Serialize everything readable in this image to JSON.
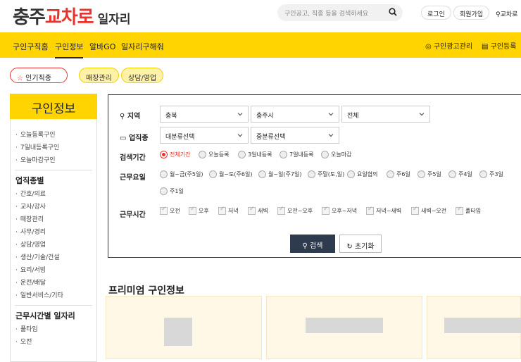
{
  "header": {
    "logo_part1": "충주",
    "logo_part2": "교차로",
    "logo_part3": "일자리",
    "search_placeholder": "구인공고, 직종 등을 검색하세요",
    "login": "로그인",
    "signup": "회원가입",
    "link": "교차로"
  },
  "nav": {
    "items": [
      "구인구직홈",
      "구인정보",
      "알바GO",
      "일자리구해줘"
    ],
    "right": [
      "구인광고관리",
      "구인등록"
    ]
  },
  "chips": [
    "인기직종",
    "매장관리",
    "상담/영업"
  ],
  "sidebar": {
    "title": "구인정보",
    "links1": [
      "오늘등록구인",
      "7일내등록구인",
      "오늘마감구인"
    ],
    "section1": "업직종별",
    "links2": [
      "간호/의료",
      "교사/강사",
      "매장관리",
      "사무/경리",
      "상담/영업",
      "생산/기술/건설",
      "요리/서빙",
      "운전/배달",
      "일반서비스/기타"
    ],
    "section2": "근무시간별 일자리",
    "links3": [
      "풀타임",
      "오전"
    ]
  },
  "filter": {
    "region_label": "지역",
    "region_sel": [
      "충북",
      "충주시",
      "전체"
    ],
    "job_label": "업직종",
    "job_sel": [
      "대분류선택",
      "중분류선택"
    ],
    "period_label": "검색기간",
    "period_opts": [
      "전체기간",
      "오늘등록",
      "3일내등록",
      "7일내등록",
      "오늘마감"
    ],
    "day_label": "근무요일",
    "day_opts": [
      "월~금(주5일)",
      "월~토(주6일)",
      "월~일(주7일)",
      "주말(토,일)",
      "요일협의",
      "주6일",
      "주5일",
      "주4일",
      "주3일"
    ],
    "day_opts2": [
      "주1일"
    ],
    "time_label": "근무시간",
    "time_opts": [
      "오전",
      "오후",
      "저녁",
      "새벽",
      "오전~오후",
      "오후~저녁",
      "저녁~새벽",
      "새벽~오전",
      "풀타임"
    ],
    "search_btn": "검색",
    "reset_btn": "초기화"
  },
  "premium": {
    "title": "프리미엄 구인정보"
  },
  "colors": {
    "brand_yellow": "#ffd400",
    "brand_red": "#e8322d",
    "dark_button": "#2e3b4e"
  }
}
